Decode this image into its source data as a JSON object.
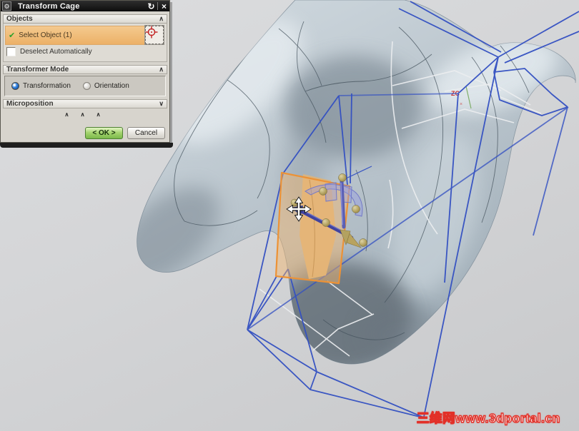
{
  "dialog": {
    "title": "Transform Cage",
    "titlebar_icons": {
      "gear": "⚙",
      "reset": "↻",
      "close": "×"
    },
    "objects_section": {
      "header": "Objects",
      "collapse_icon": "∧",
      "check_glyph": "✔",
      "select_object": "Select Object (1)",
      "deselect_automatically": "Deselect Automatically"
    },
    "transformer_mode_section": {
      "header": "Transformer Mode",
      "collapse_icon": "∧",
      "transformation": "Transformation",
      "orientation": "Orientation"
    },
    "microposition_section": {
      "header": "Microposition",
      "collapse_icon": "∨"
    },
    "resize_arrows": "∧ ∧ ∧",
    "ok_button": "< OK >",
    "cancel_button": "Cancel"
  },
  "viewport": {
    "wcs_label": "ZC",
    "watermark": "三维网www.3dportal.cn"
  },
  "colors": {
    "cage_blue": "#3350c2",
    "plane_orange": "#ec9236",
    "select_row_orange": "#f0c287",
    "ok_green": "#8cc653",
    "model_gray": "#b9c4cc",
    "handle_khaki": "#b3a25f",
    "background_gray": "#d4d5d7",
    "watermark_red": "#e23028"
  }
}
